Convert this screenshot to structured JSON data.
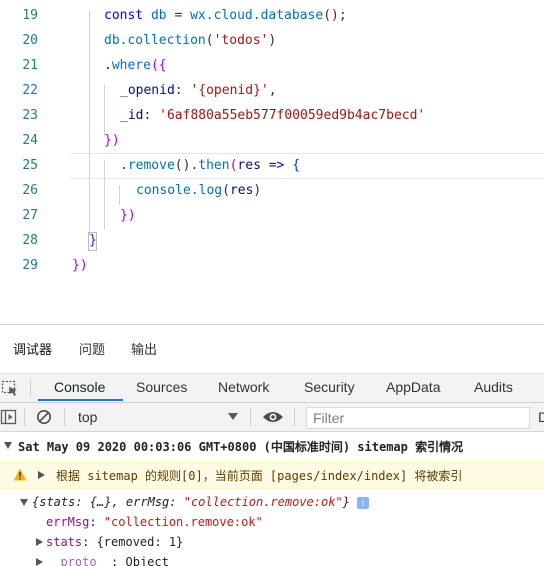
{
  "editor": {
    "lines": [
      {
        "num": "19"
      },
      {
        "num": "20"
      },
      {
        "num": "21"
      },
      {
        "num": "22"
      },
      {
        "num": "23"
      },
      {
        "num": "24"
      },
      {
        "num": "25"
      },
      {
        "num": "26"
      },
      {
        "num": "27"
      },
      {
        "num": "28"
      },
      {
        "num": "29"
      }
    ],
    "l19": {
      "a": "const",
      "b": " db ",
      "c": "=",
      "d": " wx.cloud.",
      "e": "database",
      "f": "();"
    },
    "l20": {
      "a": "db.",
      "b": "collection",
      "c": "(",
      "d": "'todos'",
      "e": ")"
    },
    "l21": {
      "a": ".",
      "b": "where",
      "c": "({"
    },
    "l22": {
      "a": "_openid",
      "b": ": ",
      "c": "'{openid}'",
      "d": ","
    },
    "l23": {
      "a": "_id",
      "b": ": ",
      "c": "'6af880a55eb577f00059ed9b4ac7becd'"
    },
    "l24": {
      "a": "})"
    },
    "l25": {
      "a": ".",
      "b": "remove",
      "c": "().",
      "d": "then",
      "e": "(",
      "f": "res",
      "g": " => ",
      "h": "{"
    },
    "l26": {
      "a": "console.",
      "b": "log",
      "c": "(",
      "d": "res",
      "e": ")"
    },
    "l27": {
      "a": "})"
    },
    "l28": {
      "a": "}"
    },
    "l29": {
      "a": "})"
    }
  },
  "devtools": {
    "top_tabs": [
      "调试器",
      "问题",
      "输出"
    ],
    "panel_tabs": [
      "Console",
      "Sources",
      "Network",
      "Security",
      "AppData",
      "Audits"
    ],
    "context": "top",
    "filter_placeholder": "Filter"
  },
  "console": {
    "msg1": "Sat May 09 2020 00:03:06 GMT+0800 (中国标准时间) sitemap 索引情况",
    "warn": "根据 sitemap 的规则[0]，当前页面 [pages/index/index] 将被索引",
    "obj_summary_a": "{stats: {…}, errMsg: ",
    "obj_summary_b": "\"collection.remove:ok\"",
    "obj_summary_c": "}",
    "info_badge": "i",
    "errmsg_key": "errMsg",
    "errmsg_val": "\"collection.remove:ok\"",
    "stats_key": "stats",
    "stats_val": "{removed: 1}",
    "proto_key": "__proto__",
    "proto_val": "Object"
  },
  "colors": {
    "accent": "#1a73e8",
    "line_numbers": "#237893",
    "warning_bg": "#fffbe5"
  }
}
